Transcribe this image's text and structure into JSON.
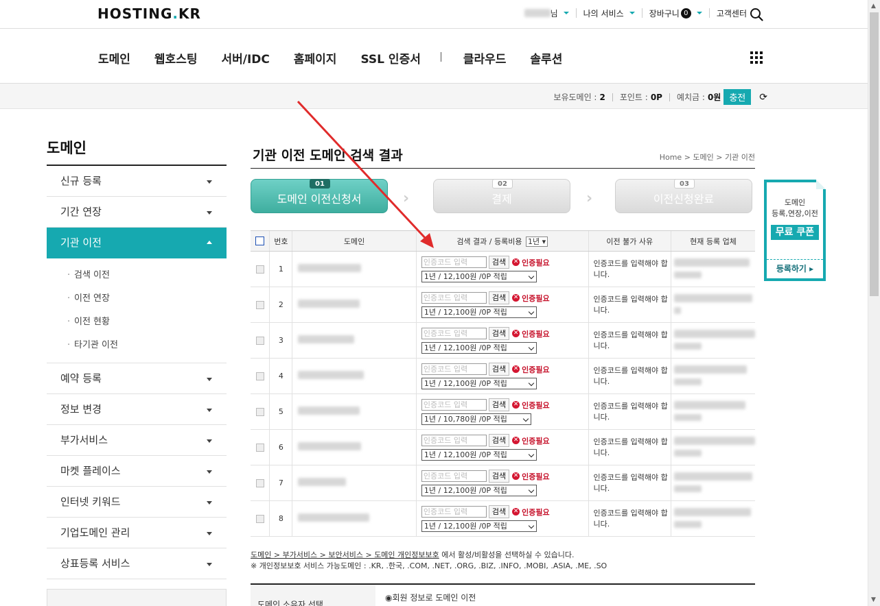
{
  "header": {
    "logo": "HOSTING.KR",
    "user_suffix": "님",
    "my_services": "나의 서비스",
    "cart": "장바구니",
    "cart_count": "0",
    "support": "고객센터"
  },
  "gnb": {
    "items": [
      "도메인",
      "웹호스팅",
      "서버/IDC",
      "홈페이지",
      "SSL 인증서"
    ],
    "items2": [
      "클라우드",
      "솔루션"
    ]
  },
  "infobar": {
    "domains_label": "보유도메인 :",
    "domains_value": "2",
    "points_label": "포인트 :",
    "points_value": "0P",
    "deposit_label": "예치금 :",
    "deposit_value": "0원",
    "charge_label": "충전"
  },
  "sidebar": {
    "title": "도메인",
    "items_top": [
      "신규 등록",
      "기간 연장"
    ],
    "active": "기관 이전",
    "sub": [
      "검색 이전",
      "이전 연장",
      "이전 현황",
      "타기관 이전"
    ],
    "items_bottom": [
      "예약 등록",
      "정보 변경",
      "부가서비스",
      "마켓 플레이스",
      "인터넷 키워드",
      "기업도메인 관리",
      "상표등록 서비스"
    ]
  },
  "main": {
    "title": "기관 이전 도메인 검색 결과",
    "breadcrumb": [
      "Home",
      "도메인",
      "기관 이전"
    ],
    "steps": [
      {
        "num": "01",
        "label": "도메인 이전신청서"
      },
      {
        "num": "02",
        "label": "결제"
      },
      {
        "num": "03",
        "label": "이전신청완료"
      }
    ],
    "table": {
      "headers": [
        "번호",
        "도메인",
        "검색 결과 / 등록비용",
        "이전 불가 사유",
        "현재 등록 업체"
      ],
      "year_select": "1년",
      "code_placeholder": "인증코드 입력",
      "search_btn": "검색",
      "need_auth": "인증필요",
      "reason": "인증코드를 입력해야 합니다.",
      "rows": [
        {
          "no": "1",
          "price": "1년 / 12,100원 /0P 적립"
        },
        {
          "no": "2",
          "price": "1년 / 12,100원 /0P 적립"
        },
        {
          "no": "3",
          "price": "1년 / 12,100원 /0P 적립"
        },
        {
          "no": "4",
          "price": "1년 / 12,100원 /0P 적립"
        },
        {
          "no": "5",
          "price": "1년 / 10,780원 /0P 적립"
        },
        {
          "no": "6",
          "price": "1년 / 12,100원 /0P 적립"
        },
        {
          "no": "7",
          "price": "1년 / 12,100원 /0P 적립"
        },
        {
          "no": "8",
          "price": "1년 / 12,100원 /0P 적립"
        }
      ]
    },
    "note": {
      "link_path": "도메인 > 부가서비스 > 보안서비스 > 도메인 개인정보보호",
      "link_suffix": " 에서 활성/비활성을 선택하실 수 있습니다.",
      "line2": "※ 개인정보보호 서비스 가능도메인 : .KR, .한국, .COM, .NET, .ORG, .BIZ, .INFO, .MOBI, .ASIA, .ME, .SO"
    },
    "owner": {
      "label": "도메인 소유자 선택",
      "option": "회원 정보로 도메인 이전"
    }
  },
  "coupon": {
    "line1": "도메인",
    "line2": "등록,연장,이전",
    "free": "무료 쿠폰",
    "register": "등록하기"
  },
  "colors": {
    "accent": "#16a9b0",
    "need_auth": "#c6122b",
    "annotation_arrow": "#e02b2b"
  }
}
